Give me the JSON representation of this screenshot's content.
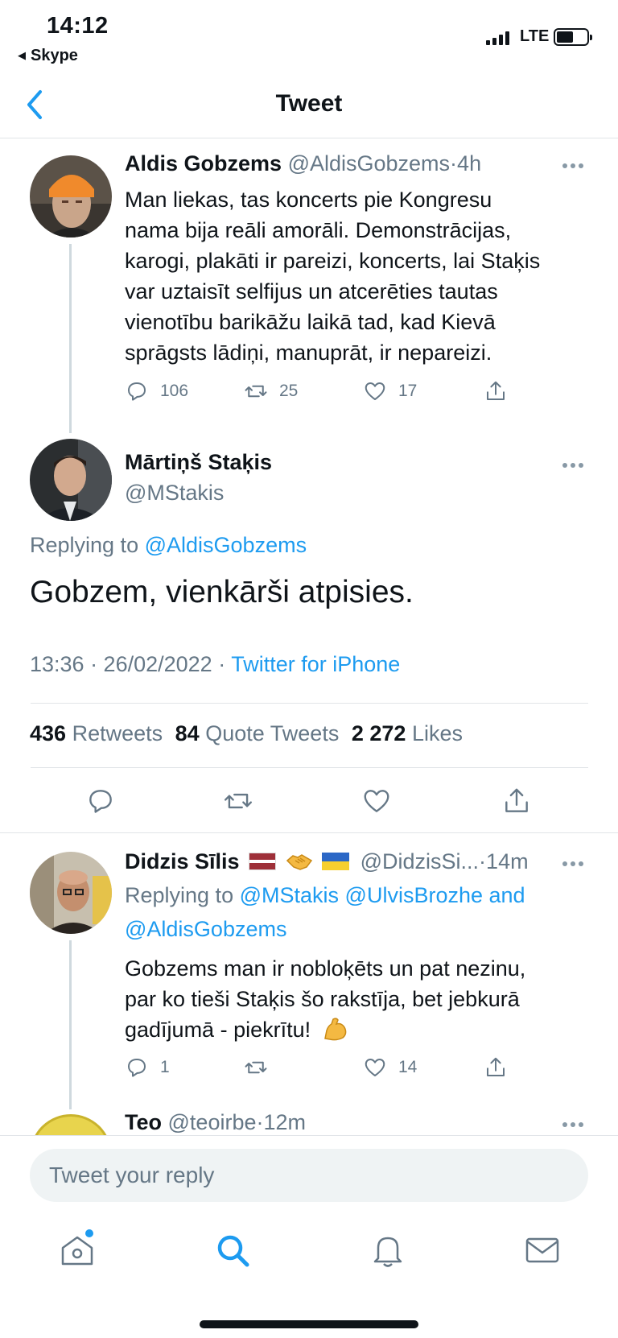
{
  "status_bar": {
    "time": "14:12",
    "back_app": "Skype",
    "network": "LTE"
  },
  "header": {
    "title": "Tweet"
  },
  "tweet1": {
    "name": "Aldis Gobzems",
    "handle": "@AldisGobzems",
    "dot": "·",
    "time": "4h",
    "lines": [
      "Man liekas, tas koncerts pie Kongresu",
      "nama bija reāli amorāli. Demonstrācijas,",
      "karogi, plakāti ir pareizi, koncerts, lai Staķis",
      "var uztaisīt selfijus un atcerēties tautas",
      "vienotību barikāžu laikā tad, kad Kievā",
      "sprāgsts lādiņi, manuprāt, ir nepareizi."
    ],
    "replies": "106",
    "retweets": "25",
    "likes": "17"
  },
  "main_tweet": {
    "name": "Mārtiņš Staķis",
    "handle": "@MStakis",
    "replying_prefix": "Replying to",
    "replying_to": "@AldisGobzems",
    "text": "Gobzem, vienkārši atpisies.",
    "timestamp": "13:36 · 26/02/2022 · ",
    "source": "Twitter for iPhone",
    "retweets_count": "436",
    "retweets_label": "Retweets",
    "quotes_count": "84",
    "quotes_label": "Quote Tweets",
    "likes_count": "2 272",
    "likes_label": "Likes"
  },
  "tweet3": {
    "name": "Didzis Sīlis",
    "emojis": [
      "flag-latvia",
      "handshake",
      "flag-ukraine"
    ],
    "handle": "@DidzisSi...",
    "dot": "·",
    "time": "14m",
    "replying_prefix": "Replying to",
    "replying_line1": "@MStakis @UlvisBrozhe and",
    "replying_line2": "@AldisGobzems",
    "lines": [
      "Gobzems man ir nobloķēts un pat nezinu,",
      "par ko tieši Staķis šo rakstīja, bet jebkurā",
      "gadījumā - piekrītu!"
    ],
    "emoji_end": "flexed-biceps",
    "replies": "1",
    "retweets": "",
    "likes": "14"
  },
  "tweet4": {
    "name": "Teo",
    "handle": "@teoirbe",
    "dot": "·",
    "time": "12m"
  },
  "reply_bar": {
    "placeholder": "Tweet your reply"
  },
  "colors": {
    "accent": "#1d9bf0",
    "muted": "#657786",
    "text": "#0f1419",
    "divider": "#e1e4e8"
  },
  "tabbar": {
    "items": [
      "home-icon",
      "search-icon",
      "notifications-icon",
      "messages-icon"
    ]
  }
}
